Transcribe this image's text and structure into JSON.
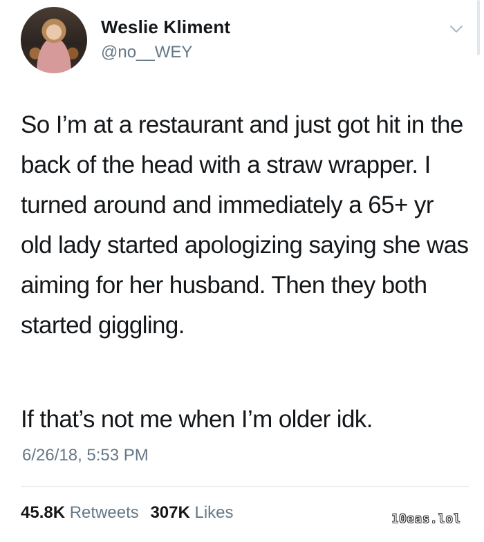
{
  "author": {
    "name": "Weslie Kliment",
    "handle": "@no__WEY",
    "avatar_icon": "profile-photo"
  },
  "menu_icon": "chevron-down-icon",
  "tweet": {
    "paragraphs": [
      "So I’m at a restaurant and just got hit in the back of the head with a straw wrapper. I turned around and immediately a 65+ yr old lady started apologizing saying she was aiming for her husband. Then they both started giggling.",
      "If that’s not me when I’m older idk."
    ],
    "timestamp": "6/26/18, 5:53 PM"
  },
  "stats": {
    "retweets_count": "45.8K",
    "retweets_label": "Retweets",
    "likes_count": "307K",
    "likes_label": "Likes"
  },
  "watermark": "10eas.lol"
}
